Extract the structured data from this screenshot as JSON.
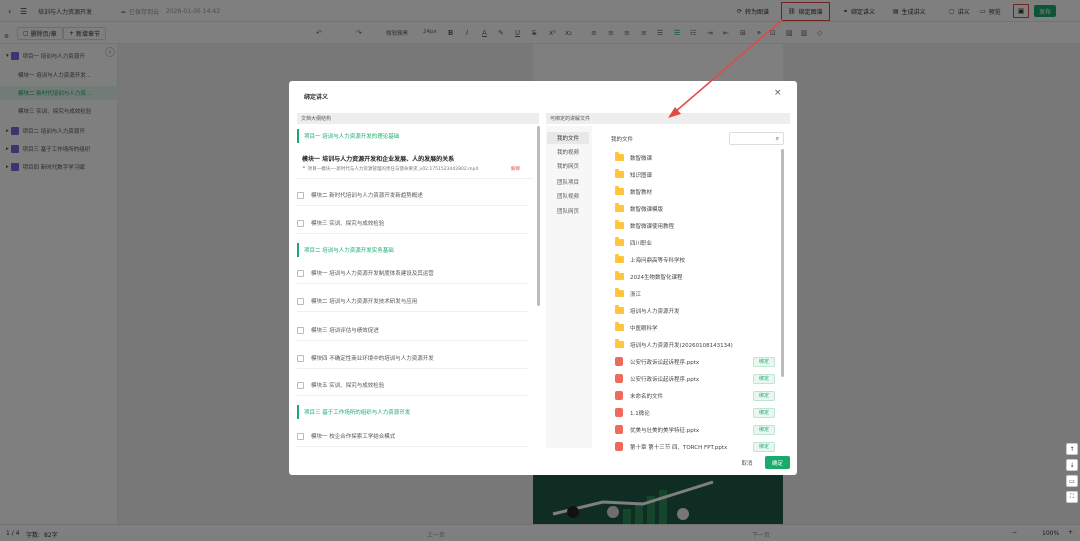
{
  "topbar": {
    "doc_title": "培训与人力资源开发",
    "saved_status": "已保存到云",
    "saved_time": "2026-01-05 14:42",
    "convert_image": "转为图谱",
    "bind_graph": "绑定图谱",
    "bind_lecture": "绑定讲义",
    "gen_lecture": "生成讲义",
    "lecture": "讲义",
    "preview": "预览",
    "publish": "发布"
  },
  "toolbar": {
    "font_name": "微软雅黑",
    "font_size": "24px"
  },
  "sidebar": {
    "delete_btn": "删除页/章",
    "add_btn": "新增章节",
    "items": [
      {
        "label": "项目一  培训与人力资源开"
      },
      {
        "label": "模块一  培训与人力资源开发..."
      },
      {
        "label": "模块二  新时代培训与人力资..."
      },
      {
        "label": "模块三  实训、探究与成效检验"
      },
      {
        "label": "项目二  培训与人力资源开"
      },
      {
        "label": "项目三  基于工作场所的组织"
      },
      {
        "label": "项目四  新时代数字学习赋"
      }
    ]
  },
  "modal": {
    "title": "绑定讲义",
    "left_header": "文档大纲结构",
    "right_header": "可绑定的讲解文件",
    "tabs": [
      "我的文件",
      "我的视频",
      "我的网页",
      "团队项目",
      "团队视频",
      "团队网页"
    ],
    "files_title": "我的文件",
    "search_placeholder": "",
    "cancel": "取消",
    "confirm": "确定",
    "chapters": [
      {
        "label": "项目一    培训与人力资源开发的理论基础"
      },
      {
        "label": "项目二    培训与人力资源开发实务基础"
      },
      {
        "label": "项目三    基于工作场所的组织与人力资源开发"
      }
    ],
    "active_module": {
      "title": "模块一    培训与人力资源开发和企业发展、人的发展的关系",
      "file": "项目一模块一-新时代与人力资源管理的责任与使命要求_v02.1751523442802.mp4",
      "unbind": "解绑"
    },
    "modules": [
      {
        "label": "模块二    新时代培训与人力资源开发新趋势概述"
      },
      {
        "label": "模块三    实训、探究与成效检验"
      },
      {
        "label": "模块一    培训与人力资源开发制度体系建设及其运营"
      },
      {
        "label": "模块二    培训与人力资源开发技术研发与应用"
      },
      {
        "label": "模块三    培训评估与绩效促进"
      },
      {
        "label": "模块四    不确定性商业环境中的培训与人力资源开发"
      },
      {
        "label": "模块五    实训、探究与成效检验"
      },
      {
        "label": "模块一    校企合作探索工学结合模式"
      }
    ],
    "bind_label": "绑定",
    "files": [
      {
        "name": "数智微课",
        "kind": "folder"
      },
      {
        "name": "知识图谱",
        "kind": "folder"
      },
      {
        "name": "数智教材",
        "kind": "folder"
      },
      {
        "name": "数智微课模版",
        "kind": "folder"
      },
      {
        "name": "数智微课使用教程",
        "kind": "folder"
      },
      {
        "name": "四川职业",
        "kind": "folder"
      },
      {
        "name": "上海问鼎高等专科学校",
        "kind": "folder"
      },
      {
        "name": "2024生物数智化课程",
        "kind": "folder"
      },
      {
        "name": "浙江",
        "kind": "folder"
      },
      {
        "name": "培训与人力资源开发",
        "kind": "folder"
      },
      {
        "name": "中医眼科学",
        "kind": "folder"
      },
      {
        "name": "培训与人力资源开发(20260108143134)",
        "kind": "folder"
      },
      {
        "name": "公安行政诉讼起诉程序.pptx",
        "kind": "ppt"
      },
      {
        "name": "公安行政诉讼起诉程序.pptx",
        "kind": "ppt"
      },
      {
        "name": "未命名的文件",
        "kind": "ppt"
      },
      {
        "name": "1.1微论",
        "kind": "ppt"
      },
      {
        "name": "优美与壮美的美学特征.pptx",
        "kind": "ppt"
      },
      {
        "name": "第十章 第十三节 四、TORCH FPT.pptx",
        "kind": "ppt"
      }
    ]
  },
  "bottombar": {
    "page_indicator": "1 / 4",
    "word_count_label": "字数:",
    "word_count": "82字",
    "prev": "上一页",
    "next": "下一页",
    "zoom": "100%"
  },
  "colors": {
    "accent": "#1aab6c",
    "annotation": "#e24a43"
  }
}
